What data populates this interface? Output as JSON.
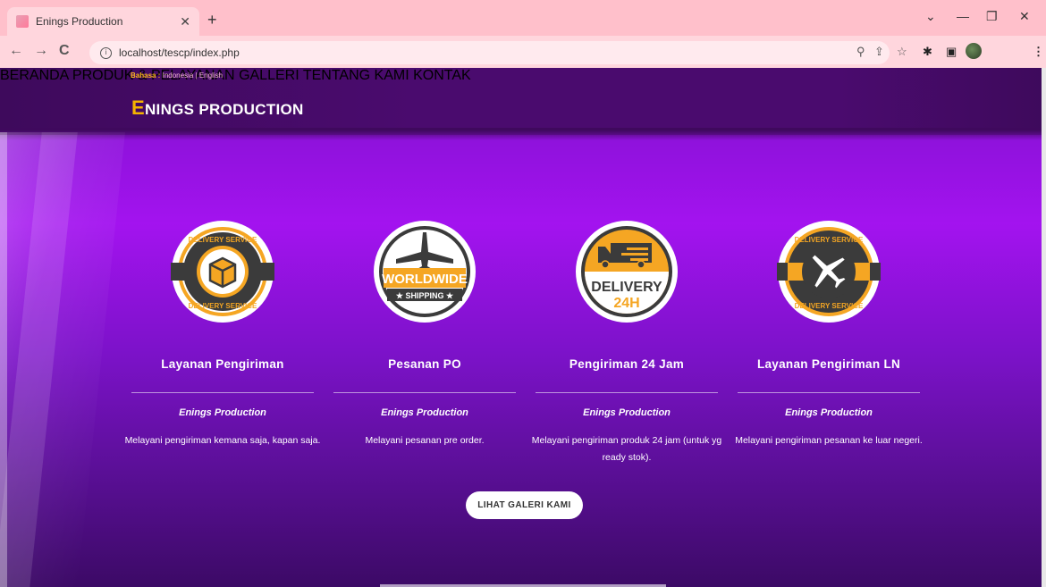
{
  "browser": {
    "tab_title": "Enings Production",
    "url": "localhost/tescp/index.php"
  },
  "header": {
    "lang_label": "Bahasa :",
    "lang_indonesia": "Indonesia",
    "lang_sep": "|",
    "lang_english": "English",
    "brand_initial": "E",
    "brand_rest": "NINGS PRODUCTION",
    "menu": [
      "BERANDA",
      "PRODUK & PELAYANAN",
      "GALLERI",
      "TENTANG KAMI",
      "KONTAK"
    ]
  },
  "services": [
    {
      "title": "Layanan Pengiriman",
      "subtitle": "Enings Production",
      "description": "Melayani pengiriman kemana saja, kapan saja.",
      "badge_text_top": "DELIVERY SERVICE",
      "badge_text_bottom": "DELIVERY SERVICE"
    },
    {
      "title": "Pesanan PO",
      "subtitle": "Enings Production",
      "description": "Melayani pesanan pre order.",
      "badge_text_top": "WORLDWIDE",
      "badge_text_bottom": "★ SHIPPING ★"
    },
    {
      "title": "Pengiriman 24 Jam",
      "subtitle": "Enings Production",
      "description": "Melayani pengiriman produk 24 jam (untuk yg ready stok).",
      "badge_text_top": "DELIVERY",
      "badge_text_bottom": "24H"
    },
    {
      "title": "Layanan Pengiriman LN",
      "subtitle": "Enings Production",
      "description": "Melayani pengiriman pesanan ke luar negeri.",
      "badge_text_top": "DELIVERY SERVICE",
      "badge_text_bottom": "DELIVERY SERVICE"
    }
  ],
  "cta_label": "LIHAT GALERI KAMI",
  "colors": {
    "accent_orange": "#f5a623",
    "badge_dark": "#3b3b3b",
    "header_bg": "#4a0b6e",
    "page_purple": "#a313ef"
  },
  "icons": {
    "badge1": "box-delivery-icon",
    "badge2": "airplane-worldwide-icon",
    "badge3": "truck-24h-icon",
    "badge4": "airplane-delivery-icon"
  }
}
